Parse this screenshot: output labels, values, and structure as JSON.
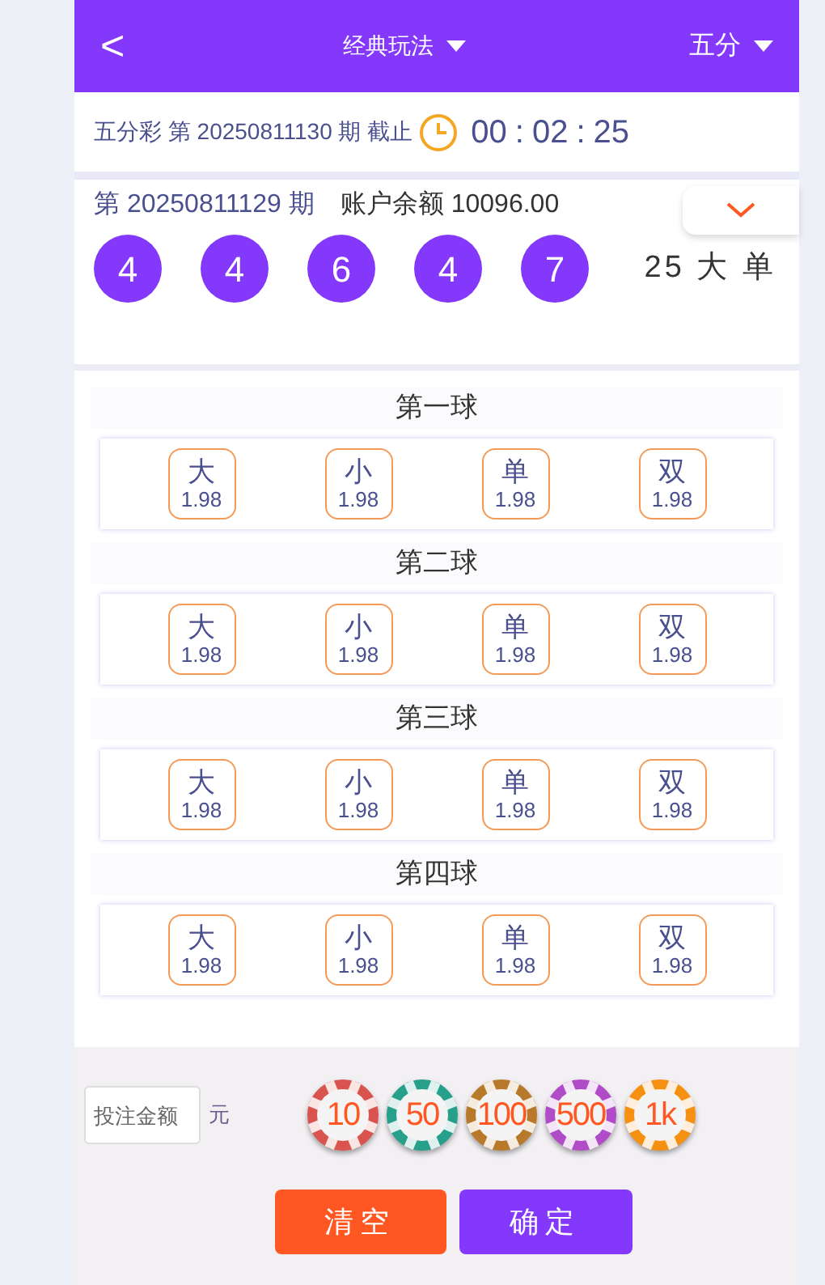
{
  "header": {
    "back": "<",
    "title": "经典玩法",
    "mode": "五分"
  },
  "countdown": {
    "label": "五分彩 第 20250811130 期 截止",
    "time": [
      "00",
      ":",
      "02",
      ":",
      "25"
    ]
  },
  "result": {
    "issue": "第 20250811129 期",
    "balance": "账户余额 10096.00",
    "balls": [
      "4",
      "4",
      "6",
      "4",
      "7"
    ],
    "summary": "25 大 单"
  },
  "sections": [
    {
      "title": "第一球",
      "options": [
        {
          "label": "大",
          "odds": "1.98"
        },
        {
          "label": "小",
          "odds": "1.98"
        },
        {
          "label": "单",
          "odds": "1.98"
        },
        {
          "label": "双",
          "odds": "1.98"
        }
      ]
    },
    {
      "title": "第二球",
      "options": [
        {
          "label": "大",
          "odds": "1.98"
        },
        {
          "label": "小",
          "odds": "1.98"
        },
        {
          "label": "单",
          "odds": "1.98"
        },
        {
          "label": "双",
          "odds": "1.98"
        }
      ]
    },
    {
      "title": "第三球",
      "options": [
        {
          "label": "大",
          "odds": "1.98"
        },
        {
          "label": "小",
          "odds": "1.98"
        },
        {
          "label": "单",
          "odds": "1.98"
        },
        {
          "label": "双",
          "odds": "1.98"
        }
      ]
    },
    {
      "title": "第四球",
      "options": [
        {
          "label": "大",
          "odds": "1.98"
        },
        {
          "label": "小",
          "odds": "1.98"
        },
        {
          "label": "单",
          "odds": "1.98"
        },
        {
          "label": "双",
          "odds": "1.98"
        }
      ]
    }
  ],
  "bet": {
    "placeholder": "投注金额",
    "unit": "元",
    "chips": [
      {
        "label": "10",
        "color": "#d9534f"
      },
      {
        "label": "50",
        "color": "#26a08a"
      },
      {
        "label": "100",
        "color": "#b8792a"
      },
      {
        "label": "500",
        "color": "#b04cc8"
      },
      {
        "label": "1k",
        "color": "#f59012"
      }
    ],
    "clear": "清空",
    "confirm": "确定"
  }
}
